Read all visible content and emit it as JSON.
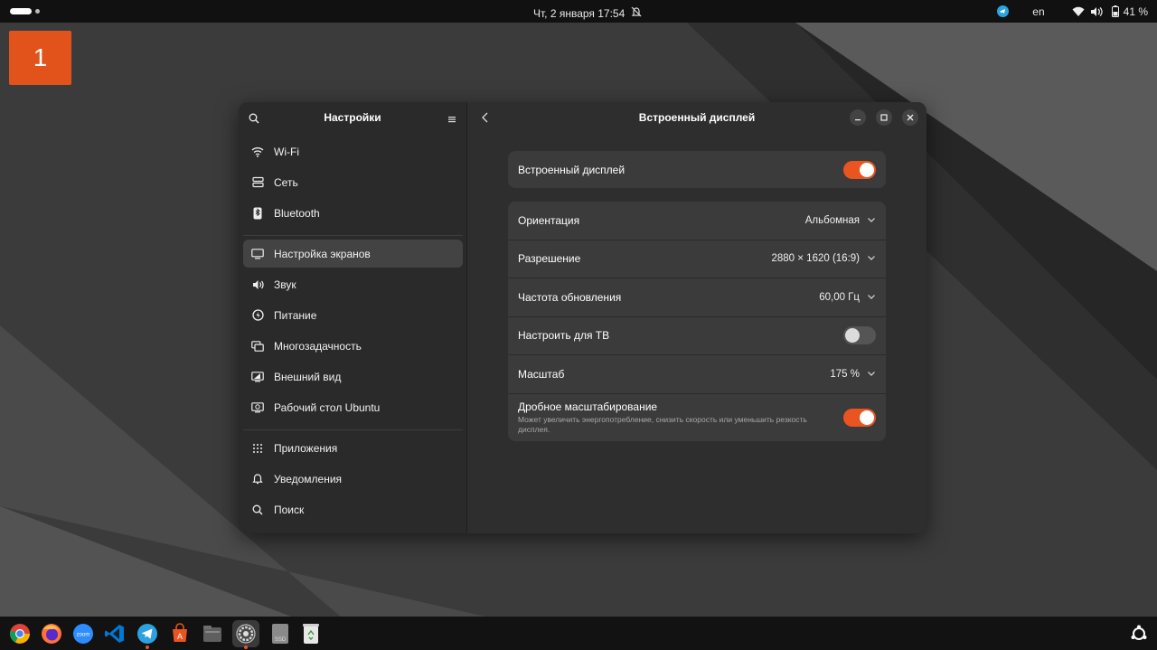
{
  "topbar": {
    "datetime": "Чт, 2 января  17:54",
    "lang": "en",
    "battery": "41 %"
  },
  "workspace": {
    "number": "1"
  },
  "window": {
    "sidebar": {
      "title": "Настройки",
      "items": [
        {
          "label": "Wi-Fi",
          "icon": "wifi-icon"
        },
        {
          "label": "Сеть",
          "icon": "network-icon"
        },
        {
          "label": "Bluetooth",
          "icon": "bluetooth-icon"
        },
        {
          "label": "Настройка экранов",
          "icon": "display-icon",
          "active": true
        },
        {
          "label": "Звук",
          "icon": "sound-icon"
        },
        {
          "label": "Питание",
          "icon": "power-icon"
        },
        {
          "label": "Многозадачность",
          "icon": "multitasking-icon"
        },
        {
          "label": "Внешний вид",
          "icon": "appearance-icon"
        },
        {
          "label": "Рабочий стол Ubuntu",
          "icon": "ubuntu-desktop-icon"
        },
        {
          "label": "Приложения",
          "icon": "apps-grid-icon"
        },
        {
          "label": "Уведомления",
          "icon": "bell-icon"
        },
        {
          "label": "Поиск",
          "icon": "search-icon"
        }
      ]
    },
    "main": {
      "title": "Встроенный дисплей",
      "builtin_display": {
        "label": "Встроенный дисплей",
        "enabled": true
      },
      "settings": [
        {
          "label": "Ориентация",
          "value": "Альбомная"
        },
        {
          "label": "Разрешение",
          "value": "2880 × 1620 (16:9)"
        },
        {
          "label": "Частота обновления",
          "value": "60,00 Гц"
        },
        {
          "label": "Настроить для ТВ",
          "toggle": false
        },
        {
          "label": "Масштаб",
          "value": "175 %"
        },
        {
          "label": "Дробное масштабирование",
          "sublabel": "Может увеличить энергопотребление, снизить скорость или уменьшить резкость дисплея.",
          "toggle": true
        }
      ]
    }
  },
  "dock": {
    "apps": [
      "chrome",
      "firefox",
      "zoom",
      "vscode",
      "telegram",
      "app-center",
      "files",
      "settings",
      "ssd",
      "trash"
    ],
    "zoom_label": "zoom",
    "ssd_label": "SSD"
  },
  "colors": {
    "accent": "#e95420"
  }
}
